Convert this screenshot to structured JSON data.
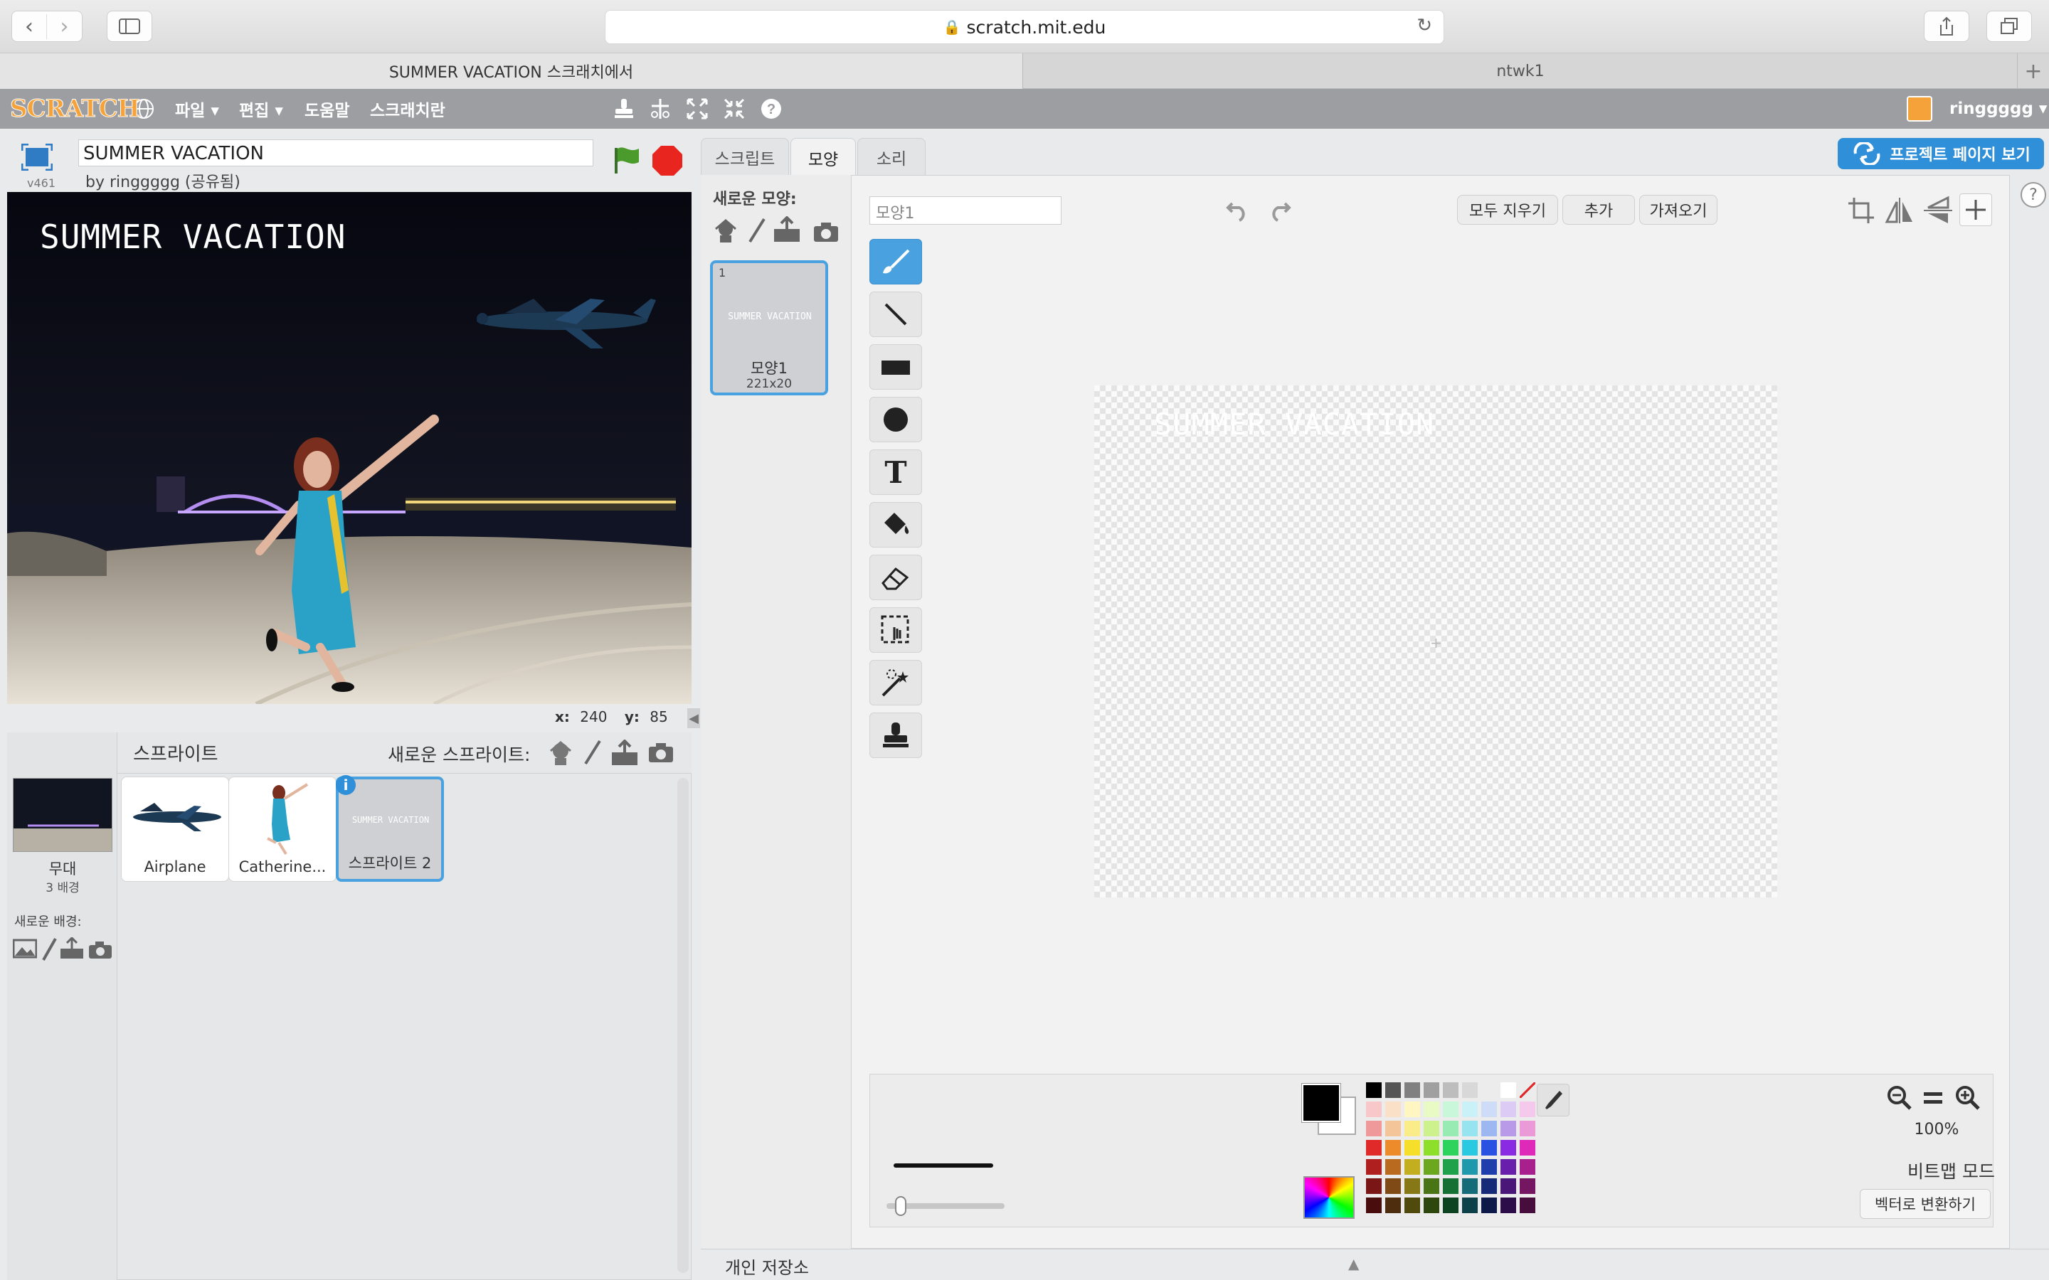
{
  "browser": {
    "url": "scratch.mit.edu",
    "tabs": [
      {
        "label": "SUMMER VACATION 스크래치에서"
      },
      {
        "label": "ntwk1"
      }
    ],
    "new_tab": "+"
  },
  "menubar": {
    "logo": "SCRATCH",
    "items": [
      "파일 ▾",
      "편집 ▾",
      "도움말",
      "스크래치란"
    ],
    "user": "ringgggg ▾"
  },
  "project": {
    "title": "SUMMER VACATION",
    "byline": "by ringgggg (공유됨)",
    "version": "v461",
    "page_button": "프로젝트 페이지 보기"
  },
  "stage": {
    "text": "SUMMER VACATION",
    "coords": {
      "x_label": "x:",
      "x": "240",
      "y_label": "y:",
      "y": "85"
    }
  },
  "sprites_pane": {
    "header": "스프라이트",
    "new_sprite": "새로운 스프라이트:",
    "stage_label": "무대",
    "stage_sub": "3 배경",
    "new_backdrop": "새로운 배경:",
    "sprites": [
      {
        "name": "Airplane"
      },
      {
        "name": "Catherine..."
      },
      {
        "name": "스프라이트 2"
      }
    ],
    "info": "i"
  },
  "editor": {
    "tabs": [
      "스크립트",
      "모양",
      "소리"
    ],
    "active_tab": "모양",
    "new_costume": "새로운 모양:",
    "costume": {
      "index": "1",
      "name": "모양1",
      "size": "221x20",
      "thumb_text": "SUMMER VACATION"
    },
    "costume_name_value": "모양1",
    "buttons": {
      "clear": "모두 지우기",
      "add": "추가",
      "import": "가져오기"
    },
    "canvas_text": "SUMMER VACATION",
    "zoom": "100%",
    "mode": "비트맵 모드",
    "convert": "벡터로 변환하기",
    "backpack": "개인 저장소",
    "help": "?"
  },
  "colors": {
    "accent": "#2f8fd8",
    "menubar": "#9c9ea2",
    "selected_border": "#4aa1e0",
    "palette": [
      [
        "#000000",
        "#555555",
        "#808080",
        "#a0a0a0",
        "#bdbdbd",
        "#d8d8d8",
        "#ececec",
        "#ffffff",
        "none"
      ],
      [
        "#f7c7c9",
        "#fbe0c8",
        "#fff6c2",
        "#e9fbc4",
        "#c9f7d9",
        "#c9f1f7",
        "#cfdcf8",
        "#dccbf5",
        "#f5c9ec"
      ],
      [
        "#f0999b",
        "#f5c59a",
        "#fbec8a",
        "#cdf18d",
        "#98ecb3",
        "#96e4f0",
        "#9db7f1",
        "#b99ae9",
        "#eb9ad8"
      ],
      [
        "#e02a2a",
        "#ed8a2a",
        "#f6df2a",
        "#8edf2a",
        "#2ed35e",
        "#29c9e2",
        "#2a52e2",
        "#8a2ae2",
        "#df2ab9"
      ],
      [
        "#b01f1f",
        "#b96a1f",
        "#c2ae1f",
        "#6ba81f",
        "#1fa04a",
        "#1f99ac",
        "#1f3eac",
        "#6a1fac",
        "#a81f8e"
      ],
      [
        "#7a1616",
        "#804a16",
        "#867816",
        "#4a7516",
        "#166f33",
        "#166b78",
        "#162b78",
        "#4a1678",
        "#751662"
      ],
      [
        "#4a0d0d",
        "#4d2d0d",
        "#514a0d",
        "#2d470d",
        "#0d4320",
        "#0d4149",
        "#0d1a49",
        "#2d0d49",
        "#470d3c"
      ]
    ]
  }
}
